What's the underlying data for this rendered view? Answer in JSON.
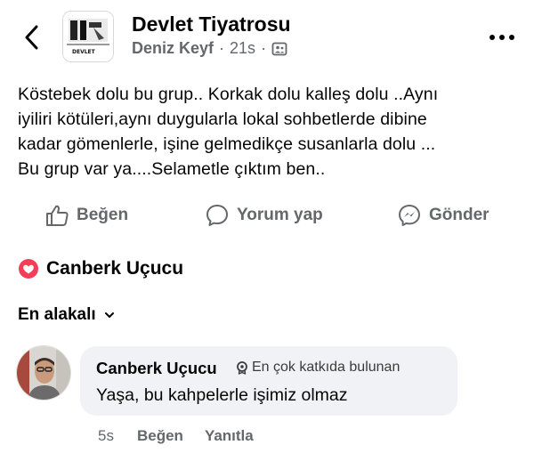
{
  "header": {
    "group_name": "Devlet Tiyatrosu",
    "author": "Deniz Keyf",
    "separator": "·",
    "time": "21s",
    "avatar_label": "DEVLET"
  },
  "post": {
    "lines": [
      "Köstebek dolu bu grup.. Korkak dolu kalleş dolu ..Aynı",
      "iyiliri kötüleri,aynı duygularla lokal sohbetlerde dibine",
      "kadar gömenlerle, işine gelmedikçe susanlarla dolu ...",
      "Bu grup var ya....Selametle çıktım ben.."
    ]
  },
  "actions": {
    "like": "Beğen",
    "comment": "Yorum yap",
    "share": "Gönder"
  },
  "reactions": {
    "name": "Canberk Uçucu",
    "reaction_color": "#f33e58"
  },
  "comments_sort": {
    "label": "En alakalı"
  },
  "comment": {
    "author": "Canberk Uçucu",
    "badge": "En çok katkıda bulunan",
    "text": "Yaşa, bu kahpelerle işimiz olmaz",
    "time": "5s",
    "like": "Beğen",
    "reply": "Yanıtla"
  },
  "colors": {
    "secondary_text": "#65676b",
    "bubble_bg": "#f0f2f5",
    "primary_text": "#050505"
  }
}
